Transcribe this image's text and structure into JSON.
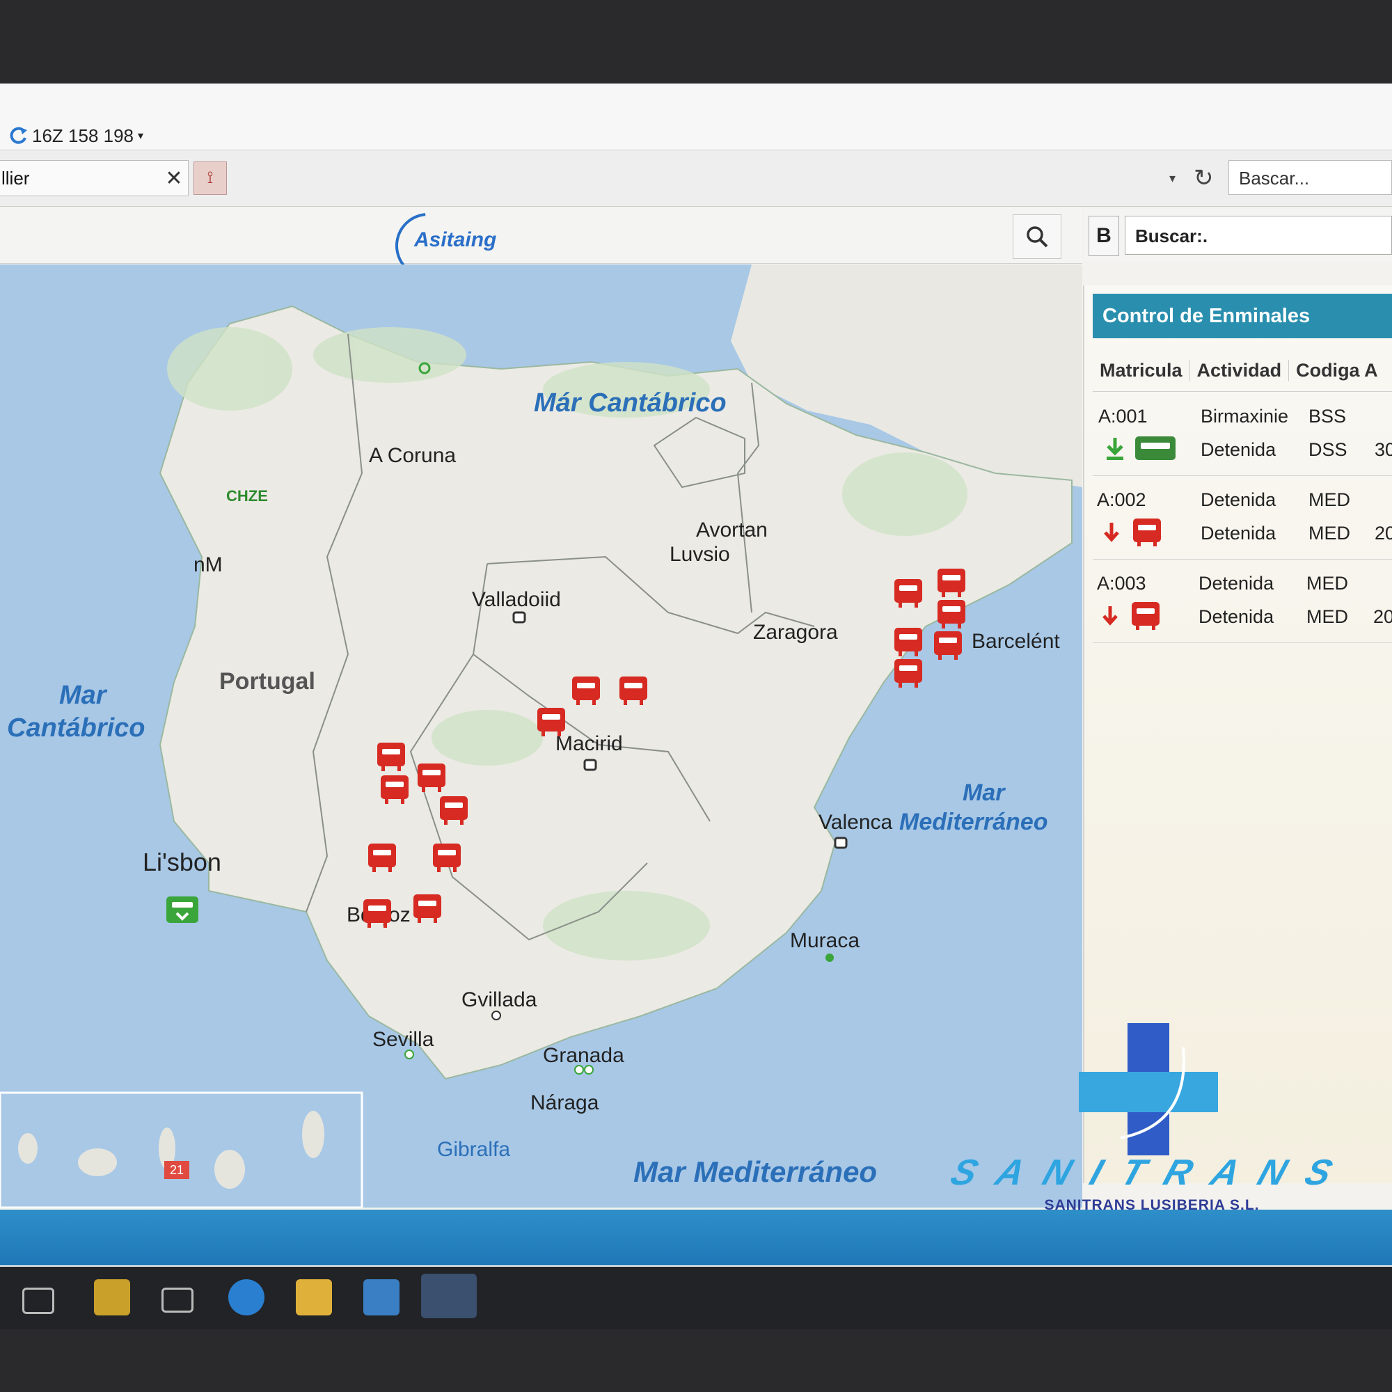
{
  "browser": {
    "address": "16Z 158 198",
    "tab_label": "llier",
    "search_placeholder": "Bascar..."
  },
  "app": {
    "logo_text": "Asitaing",
    "panel_button": "B",
    "panel_search": "Buscar:.",
    "panel_title": "Control de Enminales",
    "columns": [
      "Matricula",
      "Actividad",
      "Codiga A"
    ]
  },
  "rows": [
    {
      "id": "A:001",
      "act1": "Birmaxinie",
      "code1": "BSS",
      "act2": "Detenida",
      "code2": "DSS",
      "num2": "30"
    },
    {
      "id": "A:002",
      "act1": "Detenida",
      "code1": "MED",
      "act2": "Detenida",
      "code2": "MED",
      "num2": "20"
    },
    {
      "id": "A:003",
      "act1": "Detenida",
      "code1": "MED",
      "act2": "Detenida",
      "code2": "MED",
      "num2": "20"
    }
  ],
  "map": {
    "seas": {
      "north": "Már Cantábrico",
      "west_1": "Mar",
      "west_2": "Cantábrico",
      "east_1": "Mar",
      "east_2": "Mediterráneo",
      "south": "Mar Mediterráneo"
    },
    "countries": {
      "portugal": "Portugal"
    },
    "cities": {
      "coruna": "A Coruna",
      "chz": "CHZE",
      "nm": "nM",
      "avortan": "Avortan",
      "luvsio": "Luvsio",
      "valladolid": "Valladoiid",
      "zaragoza": "Zaragora",
      "barcelona": "Barcelént",
      "madrid": "Macirid",
      "lisbon": "Li'sbon",
      "badajoz": "Bdajoz",
      "valencia": "Valenca",
      "murcia": "Muraca",
      "gvillada": "Gvillada",
      "sevilla": "Sevilla",
      "granada": "Granada",
      "naraga": "Náraga",
      "gibraltar": "Gibralfa",
      "canary_marker": "21"
    }
  },
  "brand": {
    "word": "SANITRANS",
    "company": "SANITRANS LUSIBERIA S.L."
  },
  "colors": {
    "accent": "#2a8fae",
    "vehicle_red": "#d62a22",
    "vehicle_green": "#3aa53a",
    "sea": "#a8c8e6",
    "land": "#ebeae4"
  }
}
